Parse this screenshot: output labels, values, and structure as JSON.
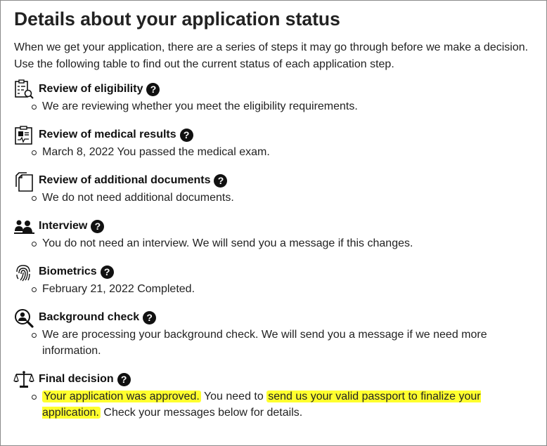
{
  "page": {
    "title": "Details about your application status",
    "intro": "When we get your application, there are a series of steps it may go through before we make a decision. Use the following table to find out the current status of each application step."
  },
  "help_glyph": "?",
  "steps": [
    {
      "icon": "clipboard-search-icon",
      "title": "Review of eligibility",
      "status": "We are reviewing whether you meet the eligibility requirements."
    },
    {
      "icon": "medical-clipboard-icon",
      "title": "Review of medical results",
      "status": "March 8, 2022 You passed the medical exam."
    },
    {
      "icon": "documents-icon",
      "title": "Review of additional documents",
      "status": "We do not need additional documents."
    },
    {
      "icon": "people-icon",
      "title": "Interview",
      "status": "You do not need an interview. We will send you a message if this changes."
    },
    {
      "icon": "fingerprint-icon",
      "title": "Biometrics",
      "status": "February 21, 2022 Completed."
    },
    {
      "icon": "person-search-icon",
      "title": "Background check",
      "status": "We are processing your background check. We will send you a message if we need more information."
    },
    {
      "icon": "scales-icon",
      "title": "Final decision",
      "status_highlight_1": "Your application was approved.",
      "status_text_1": " You need to ",
      "status_highlight_2": "send us your valid passport to finalize your application.",
      "status_text_2": " Check your messages below for details."
    }
  ],
  "colors": {
    "highlight": "#ffff2e",
    "text": "#222222",
    "icon": "#111111"
  }
}
